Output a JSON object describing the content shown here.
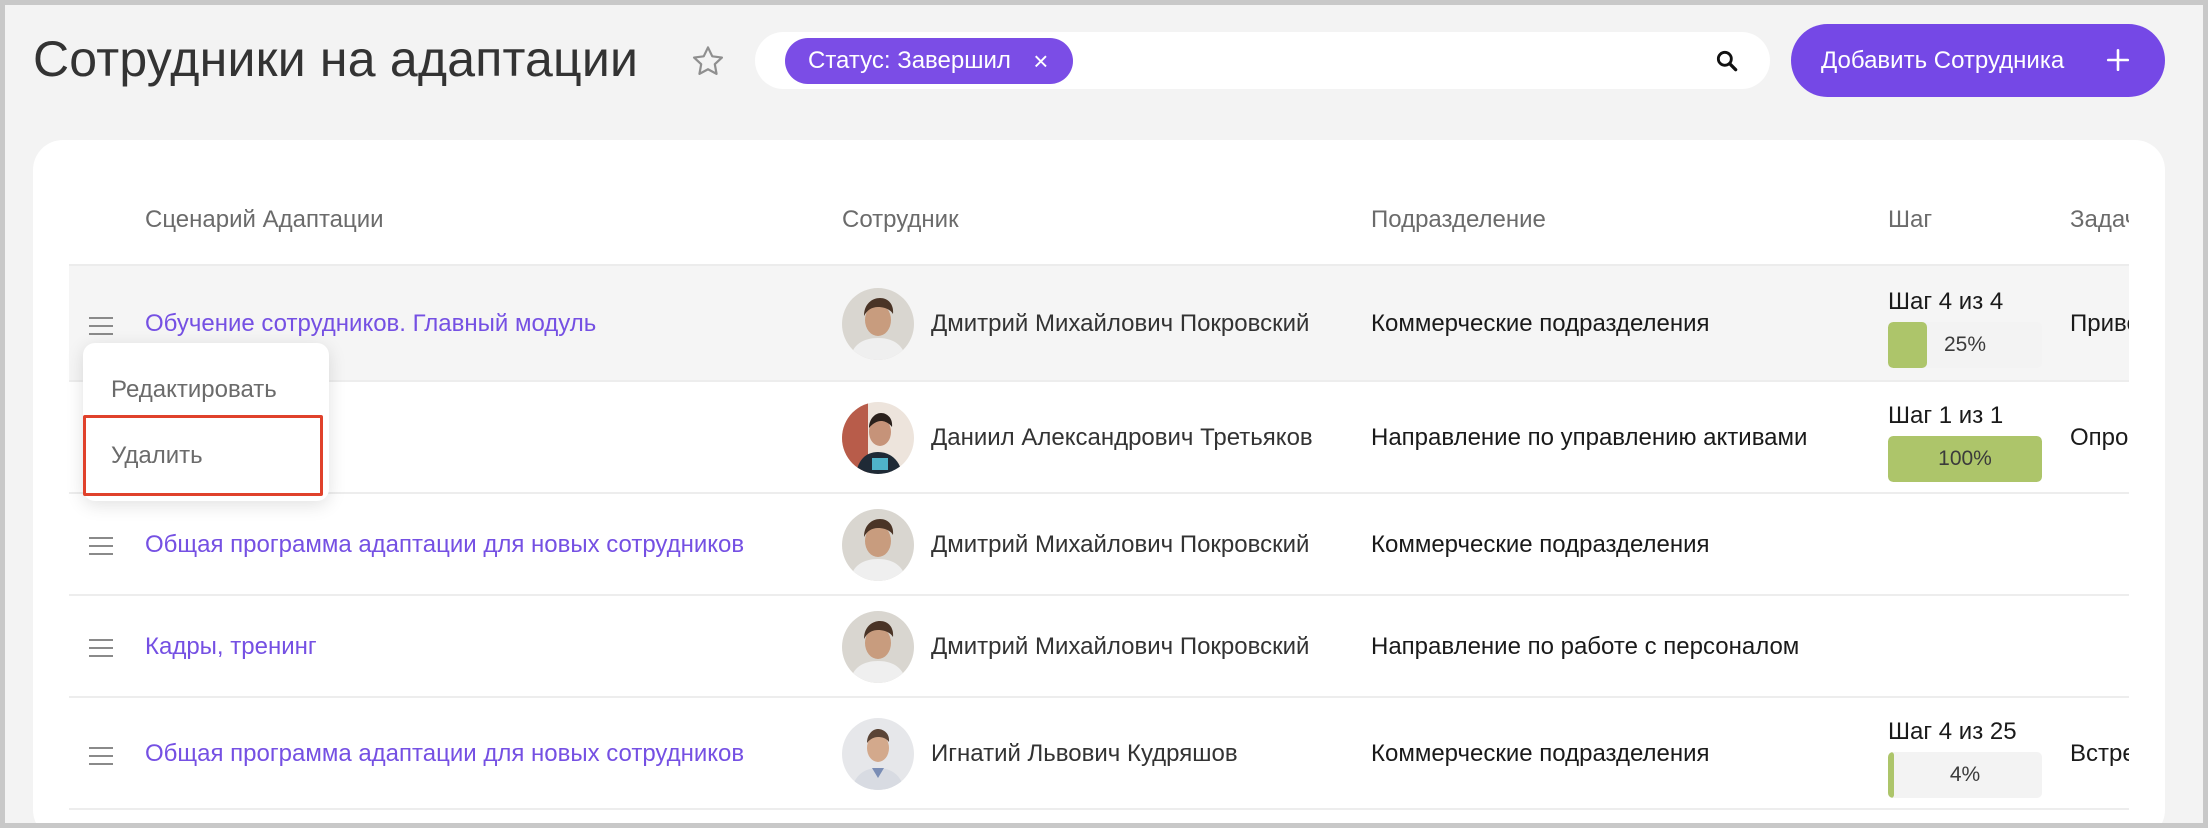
{
  "header": {
    "title": "Сотрудники на адаптации",
    "filter_chip": "Статус: Завершил",
    "chip_close": "×",
    "add_button": "Добавить Сотрудника"
  },
  "table": {
    "columns": [
      "Сценарий Адаптации",
      "Сотрудник",
      "Подразделение",
      "Шаг",
      "Задача"
    ],
    "rows": [
      {
        "scenario": "Обучение сотрудников. Главный модуль",
        "employee": "Дмитрий Михайлович Покровский",
        "department": "Коммерческие подразделения",
        "step": "Шаг 4 из 4",
        "progress": 25,
        "progress_label": "25%",
        "task": "Привет"
      },
      {
        "scenario": "",
        "employee": "Даниил Александрович Третьяков",
        "department": "Направление по управлению активами",
        "step": "Шаг 1 из 1",
        "progress": 100,
        "progress_label": "100%",
        "task": "Опрос р"
      },
      {
        "scenario": "Общая программа адаптации для новых сотрудников",
        "employee": "Дмитрий Михайлович Покровский",
        "department": "Коммерческие подразделения",
        "step": "",
        "progress_label": "",
        "task": ""
      },
      {
        "scenario": "Кадры, тренинг",
        "employee": "Дмитрий Михайлович Покровский",
        "department": "Направление по работе с персоналом",
        "step": "",
        "progress_label": "",
        "task": ""
      },
      {
        "scenario": "Общая программа адаптации для новых сотрудников",
        "employee": "Игнатий Львович Кудряшов",
        "department": "Коммерческие подразделения",
        "step": "Шаг 4 из 25",
        "progress": 4,
        "progress_label": "4%",
        "task": "Встреча"
      }
    ]
  },
  "context_menu": {
    "edit": "Редактировать",
    "delete": "Удалить"
  },
  "colors": {
    "accent": "#7548e6",
    "link": "#7550e3",
    "progress": "#adc56a",
    "highlight": "#e0412b"
  }
}
